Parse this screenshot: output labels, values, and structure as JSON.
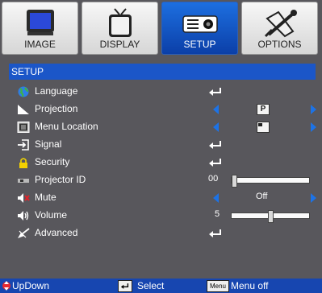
{
  "tabs": [
    {
      "label": "IMAGE",
      "icon": "monitor-icon",
      "active": false
    },
    {
      "label": "DISPLAY",
      "icon": "tv-icon",
      "active": false
    },
    {
      "label": "SETUP",
      "icon": "projector-icon",
      "active": true
    },
    {
      "label": "OPTIONS",
      "icon": "tools-icon",
      "active": false
    }
  ],
  "section_title": "SETUP",
  "menu": [
    {
      "label": "Language",
      "icon": "globe-icon",
      "control": "enter"
    },
    {
      "label": "Projection",
      "icon": "projection-icon",
      "control": "select-box",
      "value": "P"
    },
    {
      "label": "Menu Location",
      "icon": "menu-location-icon",
      "control": "select-box",
      "value": ""
    },
    {
      "label": "Signal",
      "icon": "signal-icon",
      "control": "enter"
    },
    {
      "label": "Security",
      "icon": "lock-icon",
      "control": "enter"
    },
    {
      "label": "Projector ID",
      "icon": "id-icon",
      "control": "slider",
      "value": "00",
      "level": 0
    },
    {
      "label": "Mute",
      "icon": "mute-icon",
      "control": "select",
      "value": "Off"
    },
    {
      "label": "Volume",
      "icon": "volume-icon",
      "control": "slider",
      "value": "5",
      "level": 0.5
    },
    {
      "label": "Advanced",
      "icon": "advanced-icon",
      "control": "enter"
    }
  ],
  "footer": {
    "updown": "UpDown",
    "select": "Select",
    "menu_key": "Menu",
    "menuoff": "Menu off"
  },
  "colors": {
    "background": "#58575c",
    "accent": "#1b56c8",
    "arrow": "#1d73e6"
  }
}
